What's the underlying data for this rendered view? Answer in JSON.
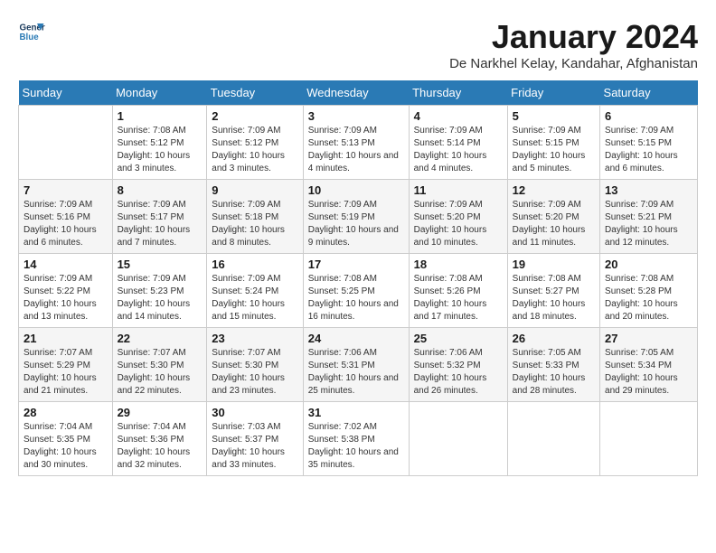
{
  "header": {
    "logo_general": "General",
    "logo_blue": "Blue",
    "title": "January 2024",
    "subtitle": "De Narkhel Kelay, Kandahar, Afghanistan"
  },
  "days_of_week": [
    "Sunday",
    "Monday",
    "Tuesday",
    "Wednesday",
    "Thursday",
    "Friday",
    "Saturday"
  ],
  "weeks": [
    [
      {
        "day": "",
        "sunrise": "",
        "sunset": "",
        "daylight": ""
      },
      {
        "day": "1",
        "sunrise": "Sunrise: 7:08 AM",
        "sunset": "Sunset: 5:12 PM",
        "daylight": "Daylight: 10 hours and 3 minutes."
      },
      {
        "day": "2",
        "sunrise": "Sunrise: 7:09 AM",
        "sunset": "Sunset: 5:12 PM",
        "daylight": "Daylight: 10 hours and 3 minutes."
      },
      {
        "day": "3",
        "sunrise": "Sunrise: 7:09 AM",
        "sunset": "Sunset: 5:13 PM",
        "daylight": "Daylight: 10 hours and 4 minutes."
      },
      {
        "day": "4",
        "sunrise": "Sunrise: 7:09 AM",
        "sunset": "Sunset: 5:14 PM",
        "daylight": "Daylight: 10 hours and 4 minutes."
      },
      {
        "day": "5",
        "sunrise": "Sunrise: 7:09 AM",
        "sunset": "Sunset: 5:15 PM",
        "daylight": "Daylight: 10 hours and 5 minutes."
      },
      {
        "day": "6",
        "sunrise": "Sunrise: 7:09 AM",
        "sunset": "Sunset: 5:15 PM",
        "daylight": "Daylight: 10 hours and 6 minutes."
      }
    ],
    [
      {
        "day": "7",
        "sunrise": "Sunrise: 7:09 AM",
        "sunset": "Sunset: 5:16 PM",
        "daylight": "Daylight: 10 hours and 6 minutes."
      },
      {
        "day": "8",
        "sunrise": "Sunrise: 7:09 AM",
        "sunset": "Sunset: 5:17 PM",
        "daylight": "Daylight: 10 hours and 7 minutes."
      },
      {
        "day": "9",
        "sunrise": "Sunrise: 7:09 AM",
        "sunset": "Sunset: 5:18 PM",
        "daylight": "Daylight: 10 hours and 8 minutes."
      },
      {
        "day": "10",
        "sunrise": "Sunrise: 7:09 AM",
        "sunset": "Sunset: 5:19 PM",
        "daylight": "Daylight: 10 hours and 9 minutes."
      },
      {
        "day": "11",
        "sunrise": "Sunrise: 7:09 AM",
        "sunset": "Sunset: 5:20 PM",
        "daylight": "Daylight: 10 hours and 10 minutes."
      },
      {
        "day": "12",
        "sunrise": "Sunrise: 7:09 AM",
        "sunset": "Sunset: 5:20 PM",
        "daylight": "Daylight: 10 hours and 11 minutes."
      },
      {
        "day": "13",
        "sunrise": "Sunrise: 7:09 AM",
        "sunset": "Sunset: 5:21 PM",
        "daylight": "Daylight: 10 hours and 12 minutes."
      }
    ],
    [
      {
        "day": "14",
        "sunrise": "Sunrise: 7:09 AM",
        "sunset": "Sunset: 5:22 PM",
        "daylight": "Daylight: 10 hours and 13 minutes."
      },
      {
        "day": "15",
        "sunrise": "Sunrise: 7:09 AM",
        "sunset": "Sunset: 5:23 PM",
        "daylight": "Daylight: 10 hours and 14 minutes."
      },
      {
        "day": "16",
        "sunrise": "Sunrise: 7:09 AM",
        "sunset": "Sunset: 5:24 PM",
        "daylight": "Daylight: 10 hours and 15 minutes."
      },
      {
        "day": "17",
        "sunrise": "Sunrise: 7:08 AM",
        "sunset": "Sunset: 5:25 PM",
        "daylight": "Daylight: 10 hours and 16 minutes."
      },
      {
        "day": "18",
        "sunrise": "Sunrise: 7:08 AM",
        "sunset": "Sunset: 5:26 PM",
        "daylight": "Daylight: 10 hours and 17 minutes."
      },
      {
        "day": "19",
        "sunrise": "Sunrise: 7:08 AM",
        "sunset": "Sunset: 5:27 PM",
        "daylight": "Daylight: 10 hours and 18 minutes."
      },
      {
        "day": "20",
        "sunrise": "Sunrise: 7:08 AM",
        "sunset": "Sunset: 5:28 PM",
        "daylight": "Daylight: 10 hours and 20 minutes."
      }
    ],
    [
      {
        "day": "21",
        "sunrise": "Sunrise: 7:07 AM",
        "sunset": "Sunset: 5:29 PM",
        "daylight": "Daylight: 10 hours and 21 minutes."
      },
      {
        "day": "22",
        "sunrise": "Sunrise: 7:07 AM",
        "sunset": "Sunset: 5:30 PM",
        "daylight": "Daylight: 10 hours and 22 minutes."
      },
      {
        "day": "23",
        "sunrise": "Sunrise: 7:07 AM",
        "sunset": "Sunset: 5:30 PM",
        "daylight": "Daylight: 10 hours and 23 minutes."
      },
      {
        "day": "24",
        "sunrise": "Sunrise: 7:06 AM",
        "sunset": "Sunset: 5:31 PM",
        "daylight": "Daylight: 10 hours and 25 minutes."
      },
      {
        "day": "25",
        "sunrise": "Sunrise: 7:06 AM",
        "sunset": "Sunset: 5:32 PM",
        "daylight": "Daylight: 10 hours and 26 minutes."
      },
      {
        "day": "26",
        "sunrise": "Sunrise: 7:05 AM",
        "sunset": "Sunset: 5:33 PM",
        "daylight": "Daylight: 10 hours and 28 minutes."
      },
      {
        "day": "27",
        "sunrise": "Sunrise: 7:05 AM",
        "sunset": "Sunset: 5:34 PM",
        "daylight": "Daylight: 10 hours and 29 minutes."
      }
    ],
    [
      {
        "day": "28",
        "sunrise": "Sunrise: 7:04 AM",
        "sunset": "Sunset: 5:35 PM",
        "daylight": "Daylight: 10 hours and 30 minutes."
      },
      {
        "day": "29",
        "sunrise": "Sunrise: 7:04 AM",
        "sunset": "Sunset: 5:36 PM",
        "daylight": "Daylight: 10 hours and 32 minutes."
      },
      {
        "day": "30",
        "sunrise": "Sunrise: 7:03 AM",
        "sunset": "Sunset: 5:37 PM",
        "daylight": "Daylight: 10 hours and 33 minutes."
      },
      {
        "day": "31",
        "sunrise": "Sunrise: 7:02 AM",
        "sunset": "Sunset: 5:38 PM",
        "daylight": "Daylight: 10 hours and 35 minutes."
      },
      {
        "day": "",
        "sunrise": "",
        "sunset": "",
        "daylight": ""
      },
      {
        "day": "",
        "sunrise": "",
        "sunset": "",
        "daylight": ""
      },
      {
        "day": "",
        "sunrise": "",
        "sunset": "",
        "daylight": ""
      }
    ]
  ]
}
